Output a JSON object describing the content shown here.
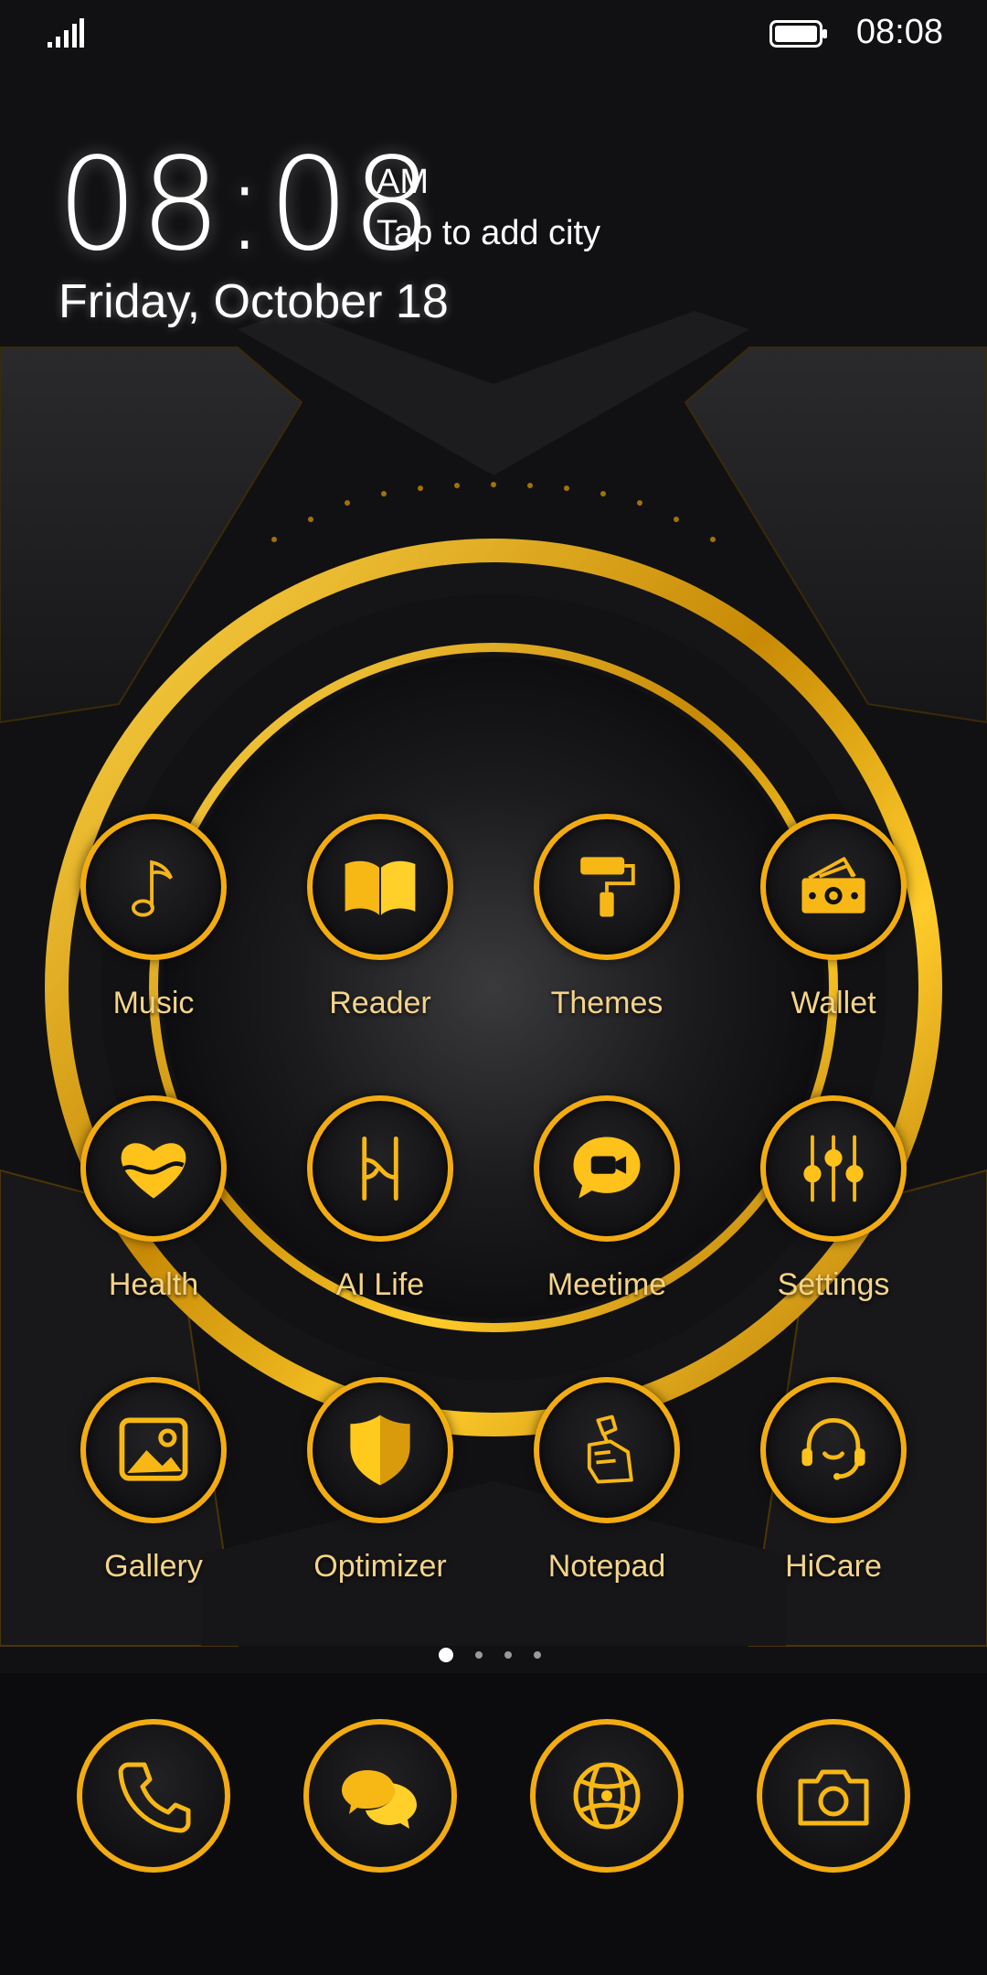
{
  "status_bar": {
    "time": "08:08",
    "signal_icon": "signal-icon",
    "battery_icon": "battery-icon"
  },
  "clock_widget": {
    "time": "08:08",
    "ampm": "AM",
    "city_prompt": "Tap to add city",
    "date": "Friday, October 18"
  },
  "apps": [
    {
      "label": "Music",
      "icon": "music-note-icon"
    },
    {
      "label": "Reader",
      "icon": "book-icon"
    },
    {
      "label": "Themes",
      "icon": "paint-roller-icon"
    },
    {
      "label": "Wallet",
      "icon": "wallet-icon"
    },
    {
      "label": "Health",
      "icon": "heart-icon"
    },
    {
      "label": "AI Life",
      "icon": "ai-life-icon"
    },
    {
      "label": "Meetime",
      "icon": "video-chat-icon"
    },
    {
      "label": "Settings",
      "icon": "sliders-icon"
    },
    {
      "label": "Gallery",
      "icon": "image-icon"
    },
    {
      "label": "Optimizer",
      "icon": "shield-icon"
    },
    {
      "label": "Notepad",
      "icon": "notepad-icon"
    },
    {
      "label": "HiCare",
      "icon": "headset-icon"
    }
  ],
  "dock": [
    {
      "icon": "phone-icon"
    },
    {
      "icon": "messages-icon"
    },
    {
      "icon": "browser-icon"
    },
    {
      "icon": "camera-icon"
    }
  ],
  "page_indicator": {
    "count": 4,
    "active": 1
  },
  "colors": {
    "accent": "#f2ac12",
    "accent_light": "#ffd21a",
    "label": "#f4d489",
    "background": "#0d0d0f"
  }
}
